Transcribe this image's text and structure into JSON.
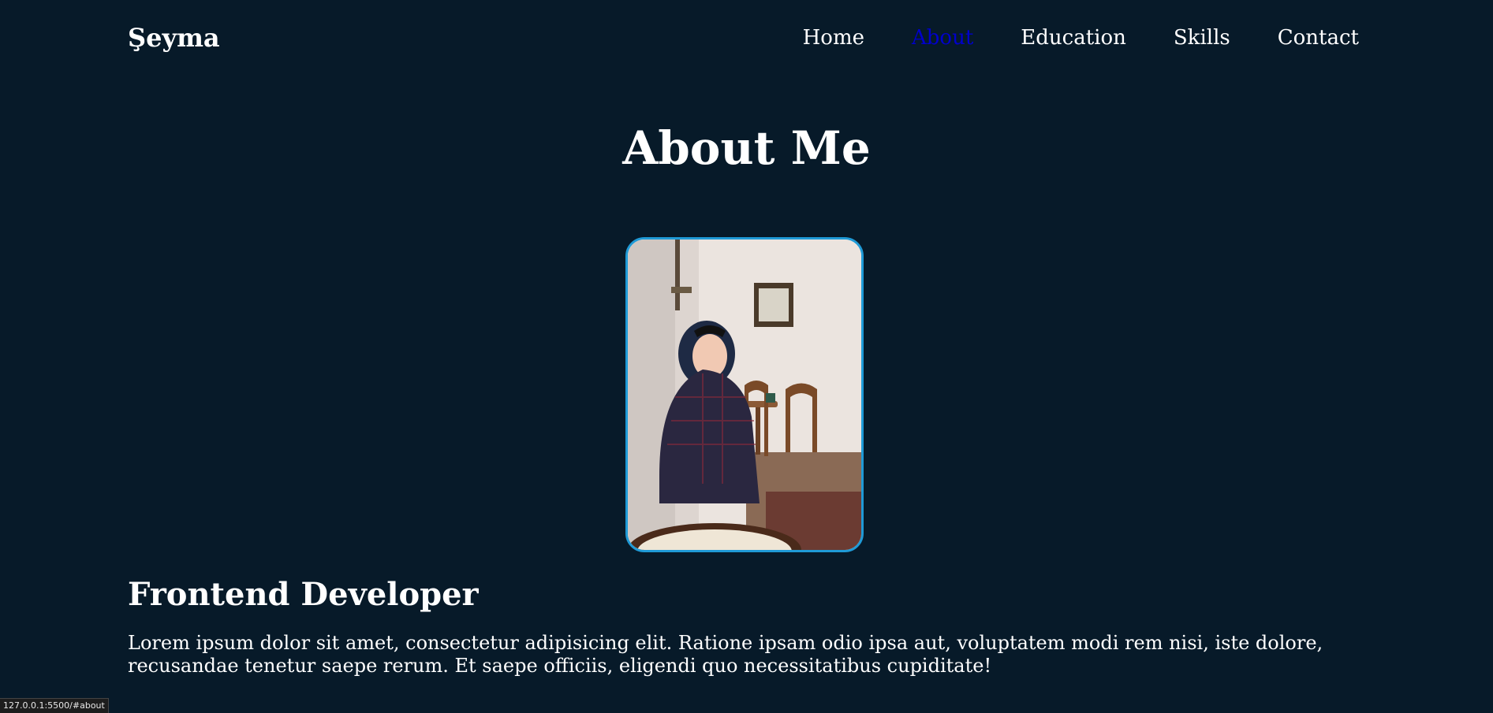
{
  "brand": "Şeyma",
  "nav": {
    "items": [
      {
        "label": "Home"
      },
      {
        "label": "About"
      },
      {
        "label": "Education"
      },
      {
        "label": "Skills"
      },
      {
        "label": "Contact"
      }
    ],
    "active_index": 1
  },
  "about": {
    "title": "About Me",
    "subtitle": "Frontend Developer",
    "description": "Lorem ipsum dolor sit amet, consectetur adipisicing elit. Ratione ipsam odio ipsa aut, voluptatem modi rem nisi, iste dolore, recusandae tenetur saepe rerum. Et saepe officiis, eligendi quo necessitatibus cupiditate!"
  },
  "status_bar": {
    "url": "127.0.0.1:5500/#about"
  },
  "colors": {
    "background": "#071a29",
    "text": "#ffffff",
    "active_link": "#0000cc",
    "photo_border": "#1f9ad6"
  }
}
